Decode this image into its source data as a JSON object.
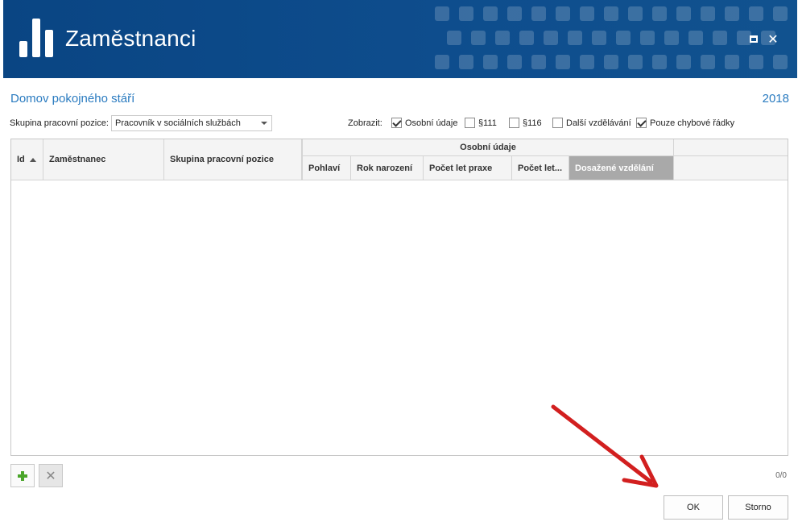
{
  "window": {
    "title": "Zaměstnanci"
  },
  "context": {
    "organization": "Domov pokojného stáří",
    "year": "2018"
  },
  "filters": {
    "group_label": "Skupina pracovní pozice:",
    "group_value": "Pracovník v sociálních službách",
    "show_label": "Zobrazit:",
    "checkboxes": [
      {
        "label": "Osobní údaje",
        "checked": true
      },
      {
        "label": "§111",
        "checked": false
      },
      {
        "label": "§116",
        "checked": false
      },
      {
        "label": "Další vzdělávání",
        "checked": false
      },
      {
        "label": "Pouze chybové řádky",
        "checked": true
      }
    ]
  },
  "grid": {
    "columns": {
      "id": "Id",
      "employee": "Zaměstnanec",
      "group": "Skupina pracovní pozice"
    },
    "group_header": "Osobní údaje",
    "sub_columns": [
      "Pohlaví",
      "Rok narození",
      "Počet let praxe",
      "Počet let...",
      "Dosažené vzdělání"
    ],
    "rows": []
  },
  "footer": {
    "count": "0/0",
    "ok_label": "OK",
    "cancel_label": "Storno"
  },
  "colors": {
    "header_bg": "#0e4d8d",
    "accent_text": "#2a7bc0",
    "annotation_arrow": "#d21f1f",
    "add_icon": "#4aa52a"
  }
}
